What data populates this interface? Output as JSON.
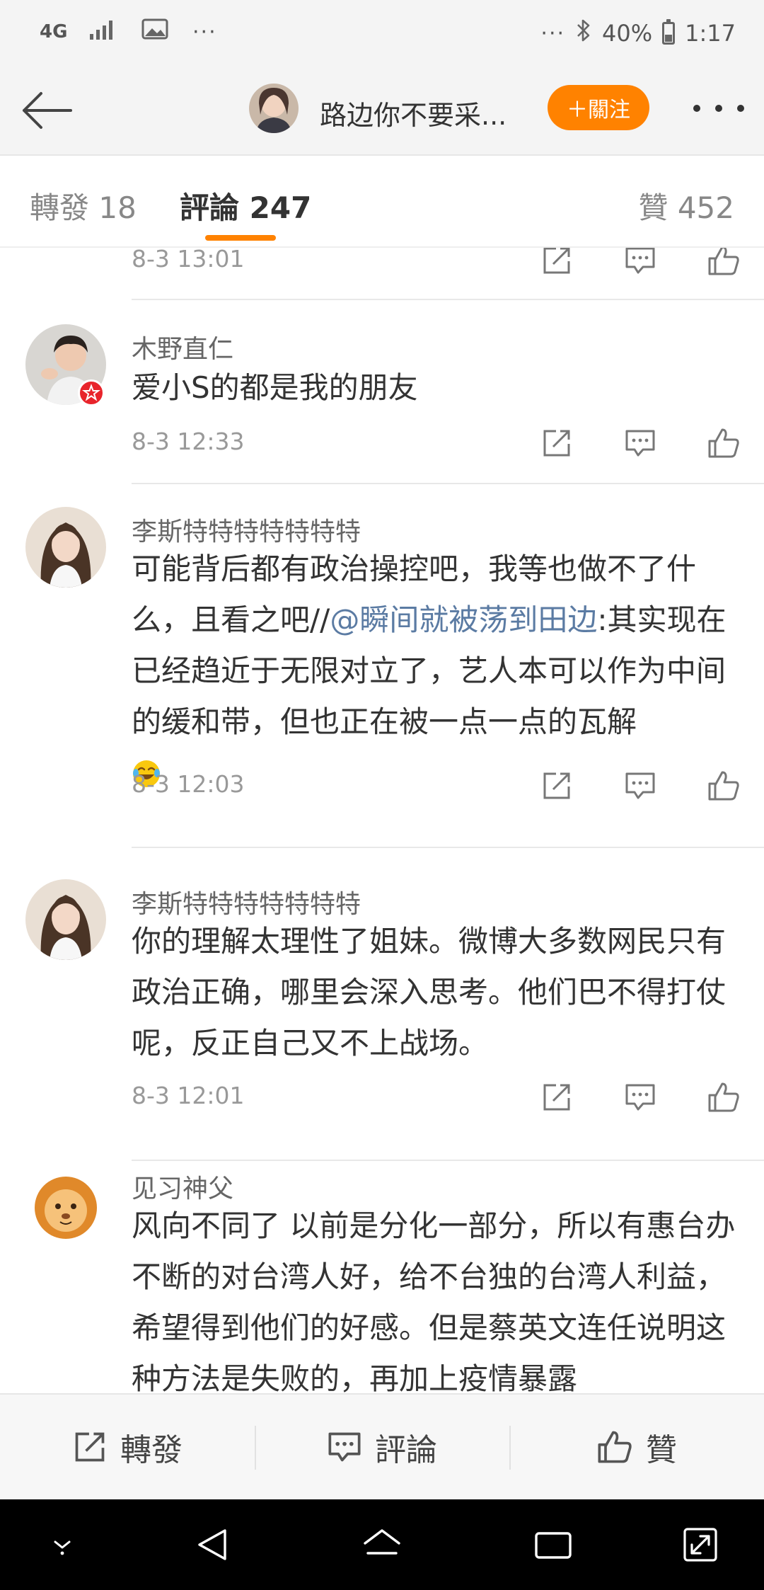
{
  "status_bar": {
    "network": "4G",
    "more": "···",
    "more_right": "···",
    "battery": "40%",
    "battery_level": 0.4,
    "time": "1:17"
  },
  "header": {
    "title": "路边你不要采...",
    "follow_label": "＋關注"
  },
  "tabs": {
    "repost": "轉發 18",
    "comments": "評論 247",
    "likes": "贊 452"
  },
  "comments": [
    {
      "time": "8-3 13:01"
    },
    {
      "name": "木野直仁",
      "text": "爱小S的都是我的朋友",
      "time": "8-3 12:33"
    },
    {
      "name": "李斯特特特特特特特",
      "text_before": "可能背后都有政治操控吧，我等也做不了什么，且看之吧//",
      "mention": "@瞬间就被荡到田边",
      "text_after": ":其实现在已经趋近于无限对立了，艺人本可以作为中间的缓和带，但也正在被一点一点的瓦解",
      "time": "8-3 12:03"
    },
    {
      "name": "李斯特特特特特特特",
      "text": "你的理解太理性了姐妹。微博大多数网民只有政治正确，哪里会深入思考。他们巴不得打仗呢，反正自己又不上战场。",
      "time": "8-3 12:01"
    },
    {
      "name": "见习神父",
      "text": "风向不同了 以前是分化一部分，所以有惠台办不断的对台湾人好，给不台独的台湾人利益，希望得到他们的好感。但是蔡英文连任说明这种方法是失败的，再加上疫情暴露"
    }
  ],
  "bottom_bar": {
    "repost": "轉發",
    "comment": "評論",
    "like": "贊"
  },
  "colors": {
    "accent": "#ff8200",
    "mention": "#5b7ba3",
    "text": "#333333",
    "meta": "#999999"
  }
}
